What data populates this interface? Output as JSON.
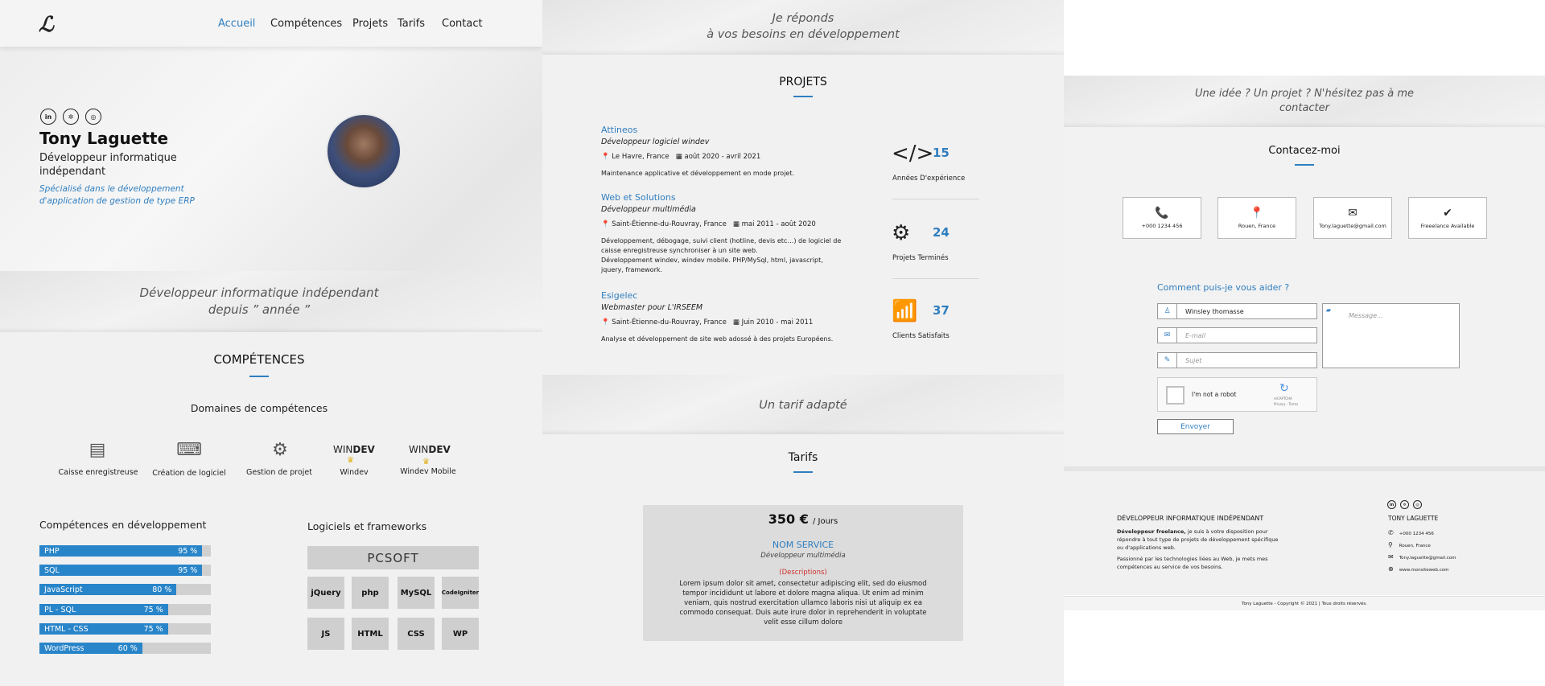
{
  "nav": {
    "logo": "ℒ",
    "items": [
      "Accueil",
      "Compétences",
      "Projets",
      "Tarifs",
      "Contact"
    ]
  },
  "hero": {
    "socials": [
      "in",
      "✲",
      "◎"
    ],
    "name": "Tony Laguette",
    "title_line1": "Développeur informatique",
    "title_line2": "indépendant",
    "tagline_line1": "Spécialisé dans le développement",
    "tagline_line2": "d'application de gestion de type ERP"
  },
  "band1": {
    "line1": "Développeur informatique indépendant",
    "line2": "depuis ” année ”"
  },
  "competences": {
    "title": "COMPÉTENCES",
    "domains_title": "Domaines de compétences",
    "domains": [
      {
        "label": "Caisse enregistreuse",
        "icon": "cash-register-icon"
      },
      {
        "label": "Création de logiciel",
        "icon": "software-icon"
      },
      {
        "label": "Gestion de projet",
        "icon": "project-icon"
      },
      {
        "label": "Windev",
        "icon": "windev-logo"
      },
      {
        "label": "Windev Mobile",
        "icon": "windev-mobile-logo"
      }
    ],
    "dev_title": "Compétences en développement",
    "skills": [
      {
        "name": "PHP",
        "pct": "95 %",
        "value": 95
      },
      {
        "name": "SQL",
        "pct": "95 %",
        "value": 95
      },
      {
        "name": "JavaScript",
        "pct": "80 %",
        "value": 80
      },
      {
        "name": "PL - SQL",
        "pct": "75 %",
        "value": 75
      },
      {
        "name": "HTML - CSS",
        "pct": "75 %",
        "value": 75
      },
      {
        "name": "WordPress",
        "pct": "60 %",
        "value": 60
      }
    ],
    "frameworks_title": "Logiciels et frameworks",
    "pcsoft": "PCSOFT",
    "logos_row1": [
      "jQuery",
      "php",
      "MySQL",
      "CodeIgniter"
    ],
    "logos_row2": [
      "JS",
      "HTML",
      "CSS",
      "WP"
    ]
  },
  "band2": {
    "line1": "Je réponds",
    "line2": "à vos besoins en développement"
  },
  "projets": {
    "title": "PROJETS",
    "jobs": [
      {
        "company": "Attineos",
        "role": "Développeur logiciel windev",
        "location": "Le Havre, France",
        "dates": "août 2020 - avril 2021",
        "desc": [
          "Maintenance applicative et développement en mode projet."
        ]
      },
      {
        "company": "Web et Solutions",
        "role": "Développeur multimédia",
        "location": "Saint-Étienne-du-Rouvray, France",
        "dates": "mai 2011 - août 2020",
        "desc": [
          "Développement, débogage, suivi client (hotline, devis etc…) de logiciel de",
          "caisse enregistreuse synchroniser à un site web.",
          "Développement windev, windev mobile. PHP/MySql, html, javascript,",
          "jquery, framework."
        ]
      },
      {
        "company": "Esigelec",
        "role": "Webmaster pour L'IRSEEM",
        "location": "Saint-Étienne-du-Rouvray, France",
        "dates": "Juin 2010 - mai 2011",
        "desc": [
          "Analyse et développement de site web adossé à des projets Européens."
        ]
      }
    ],
    "stats": [
      {
        "value": "15",
        "label": "Années D'expérience",
        "icon": "</>"
      },
      {
        "value": "24",
        "label": "Projets Terminés",
        "icon": "⚙"
      },
      {
        "value": "37",
        "label": "Clients Satisfaits",
        "icon": "📶"
      }
    ]
  },
  "band3": {
    "text": "Un tarif adapté"
  },
  "tarifs": {
    "title": "Tarifs",
    "price": "350 €",
    "unit": "/ Jours",
    "service": "NOM SERVICE",
    "sub": "Développeur multimédia",
    "desc_title": "(Descriptions)",
    "desc": [
      "Lorem ipsum dolor sit amet, consectetur adipiscing elit, sed do eiusmod",
      "tempor incididunt ut labore et dolore magna aliqua. Ut enim ad minim",
      "veniam, quis nostrud exercitation ullamco laboris nisi ut aliquip ex ea",
      "commodo consequat. Duis aute irure dolor in reprehenderit in voluptate",
      "velit esse cillum dolore"
    ]
  },
  "band4": {
    "line1": "Une idée ? Un projet ? N'hésitez pas à me",
    "line2": "contacter"
  },
  "contact": {
    "title": "Contacez-moi",
    "cards": [
      {
        "icon": "📞",
        "label": "+000 1234 456"
      },
      {
        "icon": "📍",
        "label": "Rouen, France"
      },
      {
        "icon": "✉",
        "label": "Tony.laguette@gmail.com"
      },
      {
        "icon": "✔",
        "label": "Freeelance Available"
      }
    ],
    "form_title": "Comment puis-je vous aider ?",
    "name_value": "Winsley thomasse",
    "email_ph": "E-mail",
    "subject_ph": "Sujet",
    "message_ph": "Message...",
    "captcha": "I'm not a robot",
    "captcha_brand": "reCAPTCHA",
    "captcha_links": "Privacy - Terms",
    "submit": "Envoyer"
  },
  "footer": {
    "heading": "DÉVELOPPEUR INFORMATIQUE INDÉPENDANT",
    "p1_bold": "Développeur freelance,",
    "p1": " je suis à votre disposition pour",
    "p1b": "répondre à tout type de projets de développement spécifique",
    "p1c": "ou d'applications web.",
    "p2a": "Passionné par les technologies liées au Web, je mets mes",
    "p2b": "compétences au service de vos besoins.",
    "name": "TONY LAGUETTE",
    "phone": "+000 1234 456",
    "city": "Rouen, France",
    "email": "Tony.laguette@gmail.com",
    "site": "www.monsiteweb.com",
    "copyright": "Tony Laguette - Copyright © 2021 | Tous droits réservés."
  }
}
